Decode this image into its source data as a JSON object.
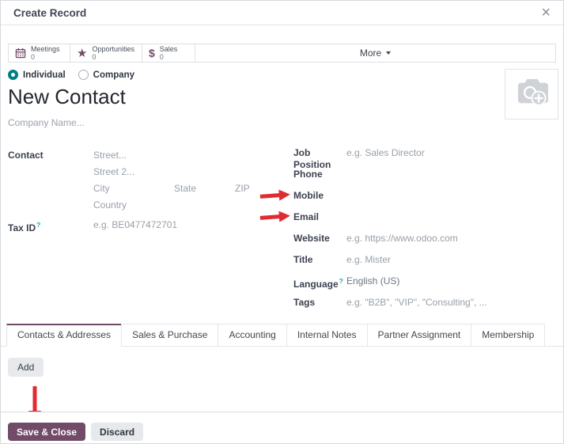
{
  "modal": {
    "title": "Create Record"
  },
  "icons": {
    "close_glyph": "×",
    "star_glyph": "★",
    "dollar_glyph": "$",
    "names": [
      "calendar-icon",
      "star-icon",
      "dollar-icon",
      "caret-down-icon",
      "close-icon",
      "camera-plus-icon",
      "red-arrow-icon",
      "question-help-icon"
    ]
  },
  "stat_buttons": [
    {
      "icon": "calendar-icon",
      "label": "Meetings",
      "count": "0"
    },
    {
      "icon": "star-icon",
      "label": "Opportunities",
      "count": "0"
    },
    {
      "icon": "dollar-icon",
      "label": "Sales",
      "count": "0"
    }
  ],
  "more_button": {
    "label": "More"
  },
  "record_type": {
    "options": [
      {
        "label": "Individual",
        "selected": true
      },
      {
        "label": "Company",
        "selected": false
      }
    ]
  },
  "name_field": {
    "value": "New Contact"
  },
  "company_field": {
    "placeholder": "Company Name..."
  },
  "address_section": {
    "label": "Contact",
    "street_placeholder": "Street...",
    "street2_placeholder": "Street 2...",
    "city_placeholder": "City",
    "state_placeholder": "State",
    "zip_placeholder": "ZIP",
    "country_placeholder": "Country"
  },
  "tax_id": {
    "label": "Tax ID",
    "help_glyph": "?",
    "placeholder": "e.g. BE0477472701"
  },
  "right_fields": [
    {
      "label": "Job Position",
      "placeholder": "e.g. Sales Director"
    },
    {
      "label": "Phone",
      "placeholder": ""
    },
    {
      "label": "Mobile",
      "placeholder": ""
    },
    {
      "label": "Email",
      "placeholder": ""
    },
    {
      "label": "Website",
      "placeholder": "e.g. https://www.odoo.com"
    },
    {
      "label": "Title",
      "placeholder": "e.g. Mister"
    },
    {
      "label": "Language",
      "help_glyph": "?",
      "value": "English (US)"
    },
    {
      "label": "Tags",
      "placeholder": "e.g. \"B2B\", \"VIP\", \"Consulting\", ..."
    }
  ],
  "tabs": [
    {
      "label": "Contacts & Addresses",
      "active": true
    },
    {
      "label": "Sales & Purchase",
      "active": false
    },
    {
      "label": "Accounting",
      "active": false
    },
    {
      "label": "Internal Notes",
      "active": false
    },
    {
      "label": "Partner Assignment",
      "active": false
    },
    {
      "label": "Membership",
      "active": false
    }
  ],
  "tab_panel": {
    "add_button": "Add"
  },
  "footer": {
    "save_button": "Save & Close",
    "discard_button": "Discard"
  },
  "annotations": {
    "arrow_color": "#df2b31",
    "targets": [
      "Mobile",
      "Email",
      "Save & Close"
    ]
  },
  "colors": {
    "primary": "#714B67",
    "radio_selected": "#017E84"
  }
}
